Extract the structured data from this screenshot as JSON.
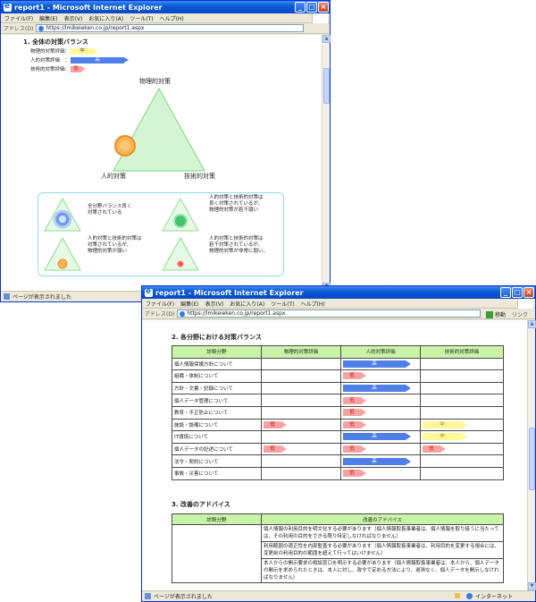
{
  "window1": {
    "title": "report1 - Microsoft Internet Explorer",
    "menu": [
      "ファイル(F)",
      "編集(E)",
      "表示(V)",
      "お気に入り(A)",
      "ツール(T)",
      "ヘルプ(H)"
    ],
    "address_label": "アドレス(D)",
    "url": "https://lmikeieken.co.jp/report1.aspx",
    "status": "ページが表示されました",
    "section_title": "1. 全体の対策バランス",
    "balance_rows": [
      {
        "label": "物理的対策評価：",
        "level": "中"
      },
      {
        "label": "人的対策評価　：",
        "level": "高"
      },
      {
        "label": "技術的対策評価：",
        "level": "低"
      }
    ],
    "triangle": {
      "top": "物理的対策",
      "left": "人的対策",
      "right": "技術的対策"
    },
    "legend": [
      "全分野バランス良く\n対策されている",
      "人的対策と技術的対策は\n良く対策されているが、\n物理的対策が若干弱い",
      "人的対策と技術的対策は\n対策されているが、\n物理的対策が弱い",
      "人的対策と技術的対策は\n若干対策されているが、\n物理的対策が非常に弱い。"
    ]
  },
  "window2": {
    "title": "report1 - Microsoft Internet Explorer",
    "menu": [
      "ファイル(F)",
      "編集(E)",
      "表示(V)",
      "お気に入り(A)",
      "ツール(T)",
      "ヘルプ(H)"
    ],
    "address_label": "アドレス(D)",
    "url": "https://lmikeieken.co.jp/report1.aspx",
    "go_label": "移動",
    "links_label": "リンク",
    "status": "ページが表示されました",
    "zone": "インターネット",
    "section2_title": "2. 各分野における対策バランス",
    "table_headers": [
      "診断分野",
      "物理的対策評価",
      "人的対策評価",
      "技術的対策評価"
    ],
    "table_rows": [
      {
        "field": "個人情報保護方針について",
        "physical": "",
        "human": "高",
        "tech": ""
      },
      {
        "field": "組織・体制について",
        "physical": "",
        "human": "低",
        "tech": ""
      },
      {
        "field": "方針・文書・記録について",
        "physical": "",
        "human": "高",
        "tech": ""
      },
      {
        "field": "個人データ管理について",
        "physical": "",
        "human": "低",
        "tech": ""
      },
      {
        "field": "教育・不正防止について",
        "physical": "",
        "human": "低",
        "tech": ""
      },
      {
        "field": "施設・設備について",
        "physical": "低",
        "human": "低",
        "tech": "中"
      },
      {
        "field": "IT環境について",
        "physical": "",
        "human": "高",
        "tech": "中"
      },
      {
        "field": "個人データの記述について",
        "physical": "低",
        "human": "低",
        "tech": "低"
      },
      {
        "field": "法令・契約について",
        "physical": "",
        "human": "高",
        "tech": ""
      },
      {
        "field": "事故・災害について",
        "physical": "",
        "human": "低",
        "tech": ""
      }
    ],
    "section3_title": "3. 改善のアドバイス",
    "advice_headers": [
      "診断分野",
      "改善のアドバイス"
    ],
    "advice_items": [
      "個人情報の利用目的を明文化する必要があります（個人情報取扱事業者は、個人情報を取り扱うに当たっては、その利用の目的をできる限り特定しなければなりません）",
      "利用範囲の適正性を内部監査する必要があります（個人情報取扱事業者は、利用目的を変更する場合には、変更前の利用目的の範囲を超えて行ってはいけません）",
      "本人からの開示要求の相談窓口を明示する必要があります（個人情報取扱事業者は、本人から、個人データの開示を求められたときは、本人に対し、政令で定める方法により、遅滞なく、個人データを開示しなければなりません）"
    ]
  },
  "colors": {
    "high": "#4f7fe8",
    "mid": "#fff899",
    "low": "#f7a3a3",
    "header_green": "#c8f3a8",
    "triangle_fill": "#d4f5d4"
  }
}
